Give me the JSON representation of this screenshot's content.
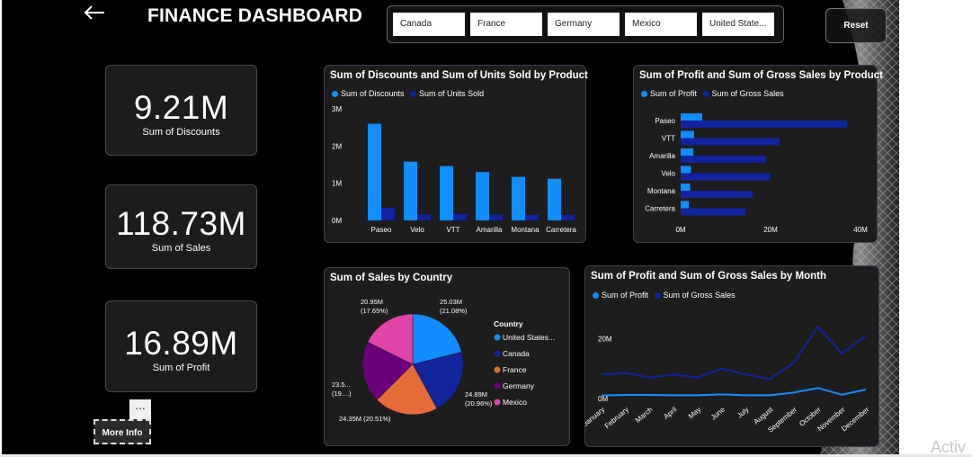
{
  "dashboard": {
    "title": "FINANCE DASHBOARD",
    "countries": [
      "Canada",
      "France",
      "Germany",
      "Mexico",
      "United State..."
    ],
    "reset_label": "Reset",
    "more_dots": "...",
    "more_info_label": "More Info",
    "watermark": "Activ"
  },
  "cards": [
    {
      "value": "9.21M",
      "label": "Sum of Discounts"
    },
    {
      "value": "118.73M",
      "label": "Sum of Sales"
    },
    {
      "value": "16.89M",
      "label": "Sum of Profit"
    }
  ],
  "colors": {
    "light_blue": "#118dff",
    "dark_blue": "#12239e",
    "orange": "#e66c37",
    "purple": "#6b007b",
    "pink": "#e044a7"
  },
  "chart_data": [
    {
      "type": "bar",
      "title": "Sum of Discounts and Sum of Units Sold by Product",
      "categories": [
        "Paseo",
        "Velo",
        "VTT",
        "Amarilla",
        "Montana",
        "Carretera"
      ],
      "series": [
        {
          "name": "Sum of Discounts",
          "values": [
            2.6,
            1.58,
            1.46,
            1.3,
            1.17,
            1.12
          ]
        },
        {
          "name": "Sum of Units Sold",
          "values": [
            0.34,
            0.16,
            0.17,
            0.16,
            0.15,
            0.15
          ]
        }
      ],
      "y_ticks": [
        "0M",
        "1M",
        "2M",
        "3M"
      ],
      "ylim": [
        0,
        3
      ]
    },
    {
      "type": "bar",
      "title": "Sum of Profit and Sum of Gross Sales by Product",
      "categories": [
        "Paseo",
        "VTT",
        "Amarilla",
        "Velo",
        "Montana",
        "Carretera"
      ],
      "series": [
        {
          "name": "Sum of Profit",
          "values": [
            4.8,
            3.0,
            2.8,
            2.3,
            2.1,
            1.8
          ]
        },
        {
          "name": "Sum of Gross Sales",
          "values": [
            37.0,
            22.0,
            19.0,
            20.0,
            16.0,
            14.5
          ]
        }
      ],
      "x_ticks": [
        "0M",
        "20M",
        "40M"
      ],
      "xlim": [
        0,
        40
      ]
    },
    {
      "type": "pie",
      "title": "Sum of Sales by Country",
      "legend_title": "Country",
      "slices": [
        {
          "name": "United States...",
          "value": 25.03,
          "label": "25.03M\n(21.08%)"
        },
        {
          "name": "Canada",
          "value": 24.89,
          "label": "24.89M\n(20.96%)"
        },
        {
          "name": "France",
          "value": 24.35,
          "label": "24.35M (20.51%)"
        },
        {
          "name": "Germany",
          "value": 23.5,
          "label": "23.5...\n(19....)"
        },
        {
          "name": "Mexico",
          "value": 20.95,
          "label": "20.95M\n(17.65%)"
        }
      ]
    },
    {
      "type": "line",
      "title": "Sum of Profit and Sum of Gross Sales by Month",
      "categories": [
        "January",
        "February",
        "March",
        "April",
        "May",
        "June",
        "July",
        "August",
        "September",
        "October",
        "November",
        "December"
      ],
      "series": [
        {
          "name": "Sum of Profit",
          "values": [
            1.0,
            1.2,
            1.2,
            1.1,
            1.1,
            1.4,
            1.1,
            1.1,
            2.0,
            3.5,
            1.3,
            3.0
          ]
        },
        {
          "name": "Sum of Gross Sales",
          "values": [
            8.0,
            8.5,
            7.0,
            8.0,
            7.0,
            10.0,
            8.0,
            6.5,
            12.0,
            24.0,
            15.0,
            21.0
          ]
        }
      ],
      "y_ticks": [
        "0M",
        "20M"
      ],
      "ylim": [
        0,
        30
      ]
    }
  ]
}
